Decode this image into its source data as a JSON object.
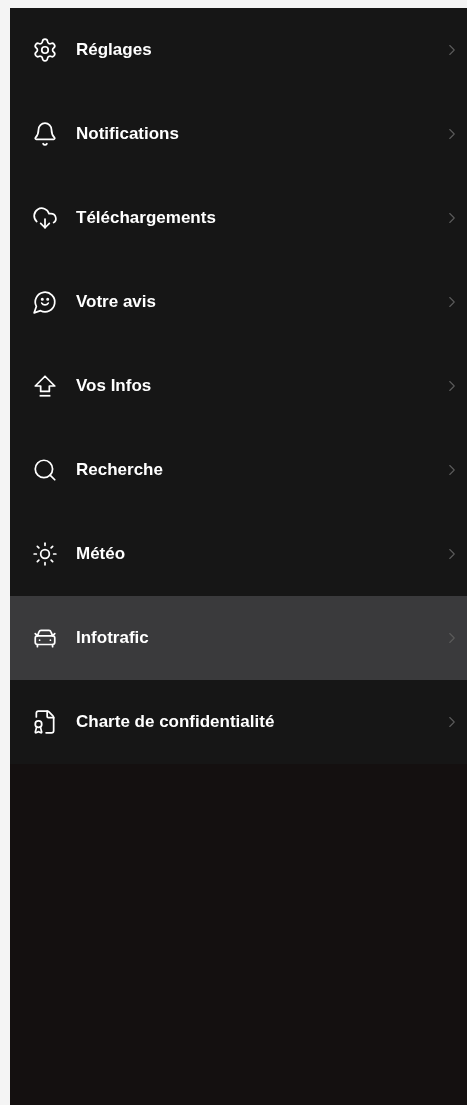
{
  "menu": {
    "items": [
      {
        "label": "Réglages",
        "selected": false
      },
      {
        "label": "Notifications",
        "selected": false
      },
      {
        "label": "Téléchargements",
        "selected": false
      },
      {
        "label": "Votre avis",
        "selected": false
      },
      {
        "label": "Vos Infos",
        "selected": false
      },
      {
        "label": "Recherche",
        "selected": false
      },
      {
        "label": "Météo",
        "selected": false
      },
      {
        "label": "Infotrafic",
        "selected": true
      },
      {
        "label": "Charte de confidentialité",
        "selected": false
      }
    ]
  }
}
